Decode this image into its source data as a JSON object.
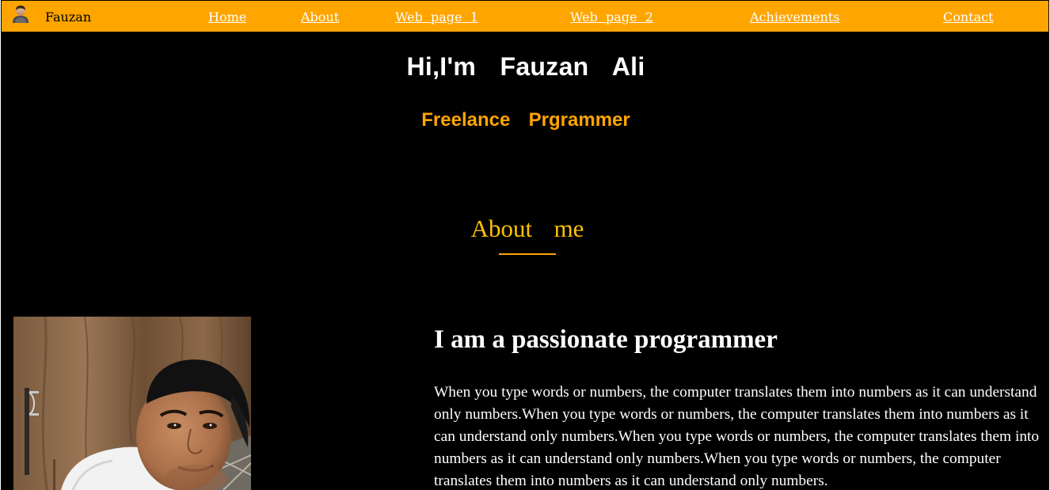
{
  "nav": {
    "user_icon": "user-avatar-icon",
    "brand": "Fauzan",
    "links": [
      {
        "label": "Home"
      },
      {
        "label": "About"
      },
      {
        "label": "Web  page  1"
      },
      {
        "label": "Web  page  2"
      },
      {
        "label": "Achievements"
      },
      {
        "label": "Contact"
      }
    ]
  },
  "hero": {
    "title": "Hi,I'm  Fauzan  Ali",
    "subtitle": "Freelance  Prgrammer"
  },
  "about": {
    "heading": "About  me",
    "title": "I am a passionate programmer",
    "paragraph": "When you type words or numbers, the computer translates them into numbers as it can understand only numbers.When you type words or numbers, the computer translates them into numbers as it can understand only numbers.When you type words or numbers, the computer translates them into numbers as it can understand only numbers.When you type words or numbers, the computer translates them into numbers as it can understand only numbers."
  },
  "colors": {
    "navbar_bg": "#ffa500",
    "page_bg": "#000000",
    "accent": "#ffa500",
    "heading_accent": "#ffc107",
    "text": "#ffffff"
  }
}
